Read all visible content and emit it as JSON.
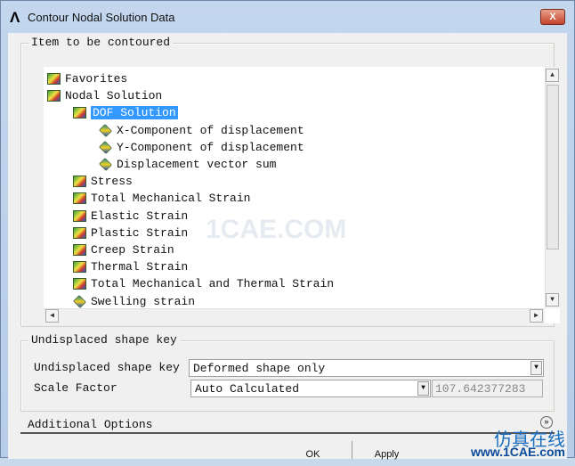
{
  "window": {
    "title": "Contour Nodal Solution Data",
    "close_label": "X"
  },
  "item_group": {
    "label": "Item to be contoured",
    "tree": [
      {
        "label": "Favorites",
        "level": 0,
        "icon": "favorites-folder-icon"
      },
      {
        "label": "Nodal Solution",
        "level": 0,
        "icon": "contour-folder-open-icon"
      },
      {
        "label": "DOF Solution",
        "level": 1,
        "icon": "contour-folder-open-icon",
        "selected": true
      },
      {
        "label": "X-Component of displacement",
        "level": 2,
        "icon": "cube-icon"
      },
      {
        "label": "Y-Component of displacement",
        "level": 2,
        "icon": "cube-icon"
      },
      {
        "label": "Displacement vector sum",
        "level": 2,
        "icon": "cube-icon"
      },
      {
        "label": "Stress",
        "level": 1,
        "icon": "contour-folder-icon"
      },
      {
        "label": "Total Mechanical Strain",
        "level": 1,
        "icon": "contour-folder-icon"
      },
      {
        "label": "Elastic Strain",
        "level": 1,
        "icon": "contour-folder-icon"
      },
      {
        "label": "Plastic Strain",
        "level": 1,
        "icon": "contour-folder-icon"
      },
      {
        "label": "Creep Strain",
        "level": 1,
        "icon": "contour-folder-icon"
      },
      {
        "label": "Thermal Strain",
        "level": 1,
        "icon": "contour-folder-icon"
      },
      {
        "label": "Total Mechanical and Thermal Strain",
        "level": 1,
        "icon": "contour-folder-icon"
      },
      {
        "label": "Swelling strain",
        "level": 1,
        "icon": "cube-icon"
      }
    ]
  },
  "undisplaced_group": {
    "label": "Undisplaced shape key",
    "key_label": "Undisplaced shape key",
    "key_value": "Deformed shape only",
    "scale_label": "Scale Factor",
    "scale_value": "Auto Calculated",
    "scale_number": "107.642377283"
  },
  "additional_options": {
    "label": "Additional Options"
  },
  "buttons": {
    "ok": "OK",
    "apply": "Apply"
  },
  "watermark": {
    "center": "1CAE.COM",
    "cn": "仿真在线",
    "url": "www.1CAE.com"
  }
}
